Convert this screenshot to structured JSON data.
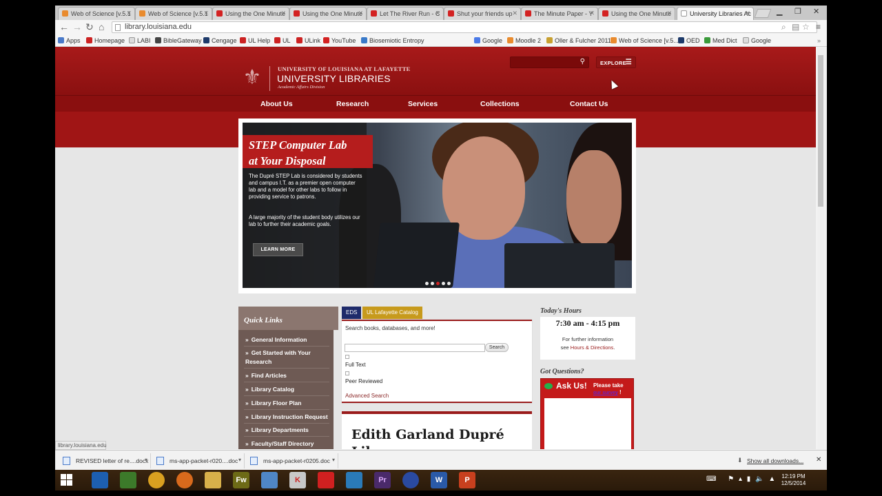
{
  "browser": {
    "tabs": [
      {
        "label": "Web of Science [v.5.1",
        "icon_color": "#e98b2e"
      },
      {
        "label": "Web of Science [v.5.1",
        "icon_color": "#e98b2e"
      },
      {
        "label": "Using the One Minute",
        "icon_color": "#d32222"
      },
      {
        "label": "Using the One Minute",
        "icon_color": "#d32222"
      },
      {
        "label": "Let The River Run - C",
        "icon_color": "#d32222"
      },
      {
        "label": "Shut your friends up",
        "icon_color": "#d32222"
      },
      {
        "label": "The Minute Paper - Y",
        "icon_color": "#d32222"
      },
      {
        "label": "Using the One Minute",
        "icon_color": "#d32222"
      },
      {
        "label": "University Libraries Ac",
        "icon_color": "#ffffff"
      }
    ],
    "url": "library.louisiana.edu",
    "bookmarks": [
      "Apps",
      "Homepage",
      "LABI",
      "BibleGateway",
      "Cengage",
      "UL Help",
      "UL",
      "ULink",
      "YouTube",
      "Biosemiotic Entropy",
      "Google",
      "Moodle 2",
      "Oller & Fulcher 2011",
      "Web of Science [v.5...",
      "OED",
      "Med Dict",
      "Google"
    ],
    "status_url": "library.louisiana.edu"
  },
  "site": {
    "university": "UNIVERSITY OF LOUISIANA AT LAFAYETTE",
    "library": "UNIVERSITY LIBRARIES",
    "division": "Academic Affairs Division",
    "explore": "EXPLORE",
    "nav": [
      "About Us",
      "Research",
      "Services",
      "Collections",
      "Contact Us"
    ],
    "hero": {
      "title_line1": "STEP Computer Lab",
      "title_line2": "at Your Disposal",
      "p1": "The Dupré STEP Lab is considered by students and campus I.T. as a premier open computer lab and a model for other labs to follow in providing service to patrons.",
      "p2": "A large majority of the student body utilizes our lab to further their academic goals.",
      "button": "LEARN MORE"
    },
    "quick_links": {
      "title": "Quick Links",
      "items": [
        "General Information",
        "Get Started with Your Research",
        "Find Articles",
        "Library Catalog",
        "Library Floor Plan",
        "Library Instruction Request",
        "Library Departments",
        "Faculty/Staff Directory"
      ]
    },
    "search": {
      "tabs": [
        "EDS",
        "UL Lafayette Catalog"
      ],
      "hint": "Search books, databases, and more!",
      "button": "Search",
      "full_text": "Full Text",
      "peer_reviewed": "Peer Reviewed",
      "advanced": "Advanced Search"
    },
    "about_title": "Edith Garland Dupré Library",
    "hours": {
      "heading": "Today's Hours",
      "time": "7:30 am - 4:15 pm",
      "note_line1": "For further information",
      "note_see": "see",
      "note_link": "Hours & Directions",
      "note_end": "."
    },
    "questions": {
      "heading": "Got Questions?",
      "askus": "Ask Us!",
      "please_take": "Please take",
      "survey": "our survey",
      "bang": "!"
    }
  },
  "downloads": {
    "items": [
      "REVISED letter of re....docx",
      "ms-app-packet-r020....doc",
      "ms-app-packet-r0205.doc"
    ],
    "show_all": "Show all downloads..."
  },
  "taskbar": {
    "apps": [
      {
        "name": "outlook",
        "label": "",
        "color": "#1d5fb0"
      },
      {
        "name": "network",
        "label": "",
        "color": "#3c7a2a"
      },
      {
        "name": "chrome",
        "label": "",
        "color": "#d9a020"
      },
      {
        "name": "firefox",
        "label": "",
        "color": "#d86a1c"
      },
      {
        "name": "explorer",
        "label": "",
        "color": "#d8b04a"
      },
      {
        "name": "fireworks",
        "label": "Fw",
        "color": "#6d6a16"
      },
      {
        "name": "remote",
        "label": "",
        "color": "#4f86c6"
      },
      {
        "name": "kaspersky",
        "label": "K",
        "color": "#c8c8c8"
      },
      {
        "name": "acrobat",
        "label": "",
        "color": "#d02020"
      },
      {
        "name": "media",
        "label": "",
        "color": "#2a7ab8"
      },
      {
        "name": "premiere",
        "label": "Pr",
        "color": "#4a2a6a"
      },
      {
        "name": "flash",
        "label": "",
        "color": "#2a4aa0"
      },
      {
        "name": "word",
        "label": "W",
        "color": "#2a5aa8"
      },
      {
        "name": "powerpoint",
        "label": "P",
        "color": "#c8401e"
      }
    ],
    "clock_time": "12:19 PM",
    "clock_date": "12/5/2014"
  }
}
